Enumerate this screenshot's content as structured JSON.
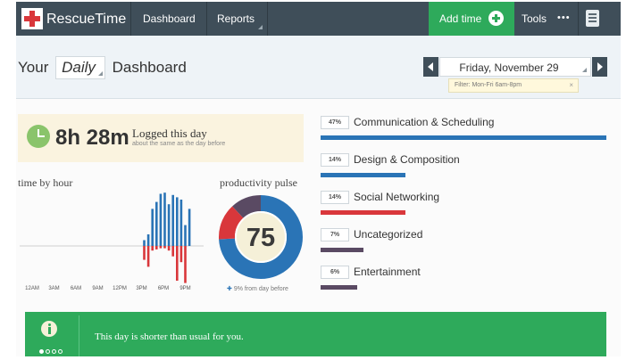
{
  "nav": {
    "brand": "RescueTime",
    "items": [
      "Dashboard",
      "Reports"
    ],
    "add_time": "Add time",
    "tools": "Tools",
    "tools_more": "•••"
  },
  "header": {
    "prefix": "Your",
    "period": "Daily",
    "suffix": "Dashboard",
    "date": "Friday, November 29",
    "filter": "Filter: Mon-Fri 6am-8pm",
    "filter_close": "×"
  },
  "summary": {
    "hours": "8h 28m",
    "label": "Logged this day",
    "sublabel": "about the same as the day before"
  },
  "time_by_hour": {
    "title": "time by hour",
    "chart_data": {
      "type": "bar",
      "x_labels": [
        "12AM",
        "3AM",
        "6AM",
        "9AM",
        "12PM",
        "3PM",
        "6PM",
        "9PM"
      ],
      "productive": [
        0,
        0,
        0,
        0,
        0,
        0,
        0,
        0,
        0,
        0,
        0,
        0,
        0,
        0,
        0,
        0,
        0,
        0,
        0,
        0,
        0,
        0,
        0,
        0,
        0,
        0,
        0,
        5,
        10,
        32,
        38,
        45,
        46,
        36,
        44,
        42,
        40,
        18,
        32,
        0
      ],
      "distracting": [
        0,
        0,
        0,
        0,
        0,
        0,
        0,
        0,
        0,
        0,
        0,
        0,
        0,
        0,
        0,
        0,
        0,
        0,
        0,
        0,
        0,
        0,
        0,
        0,
        0,
        0,
        0,
        12,
        18,
        4,
        3,
        2,
        2,
        4,
        9,
        30,
        14,
        32,
        0,
        0
      ],
      "colors": {
        "productive": "#2a74b6",
        "distracting": "#d9373b"
      }
    }
  },
  "pulse": {
    "title": "productivity pulse",
    "value": "75",
    "note_arrow": "✚",
    "note": "9% from day before",
    "chart_data": {
      "type": "pie",
      "slices": [
        {
          "value": 74,
          "color": "#2a74b6"
        },
        {
          "value": 14,
          "color": "#d9373b"
        },
        {
          "value": 12,
          "color": "#5a4a63"
        }
      ]
    }
  },
  "categories": {
    "chart_data": {
      "type": "bar",
      "items": [
        {
          "pct_label": "47%",
          "name": "Communication & Scheduling",
          "value": 47,
          "color": "#2a74b6"
        },
        {
          "pct_label": "14%",
          "name": "Design & Composition",
          "value": 14,
          "color": "#2a74b6"
        },
        {
          "pct_label": "14%",
          "name": "Social Networking",
          "value": 14,
          "color": "#d9373b"
        },
        {
          "pct_label": "7%",
          "name": "Uncategorized",
          "value": 7,
          "color": "#5a4a63"
        },
        {
          "pct_label": "6%",
          "name": "Entertainment",
          "value": 6,
          "color": "#5a4a63"
        }
      ]
    }
  },
  "banner": {
    "text": "This day is shorter than usual for you.",
    "pages": 4,
    "active_page": 1
  },
  "colors": {
    "nav_bg": "#3f4e59",
    "accent_green": "#2eaa5b",
    "productive_blue": "#2a74b6",
    "distracting_red": "#d9373b"
  }
}
